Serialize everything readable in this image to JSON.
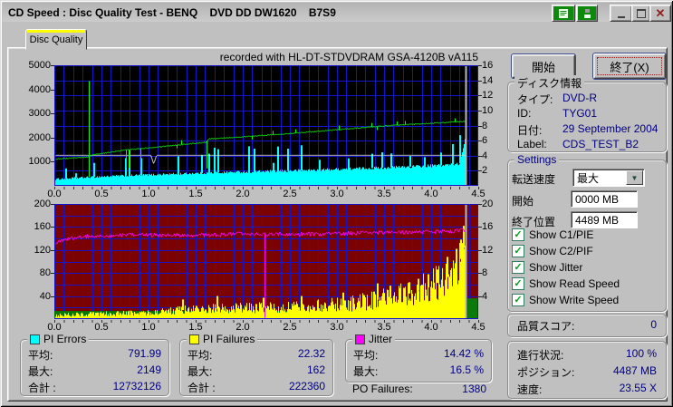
{
  "window": {
    "title": "CD Speed : Disc Quality Test - BENQ    DVD DD DW1620    B7S9"
  },
  "titlebar": {
    "icons": [
      "test-results-icon",
      "save-disk-icon",
      "minimize-icon",
      "maximize-icon",
      "close-icon"
    ]
  },
  "tab": {
    "label": "Disc Quality"
  },
  "actions": {
    "start": "開始",
    "exit": "終了(X)"
  },
  "disc_info": {
    "title": "ディスク情報",
    "type_label": "タイプ:",
    "type_value": "DVD-R",
    "id_label": "ID:",
    "id_value": "TYG01",
    "date_label": "日付:",
    "date_value": "29 September 2004",
    "label_label": "Label:",
    "label_value": "CDS_TEST_B2"
  },
  "settings": {
    "title": "Settings",
    "speed_label": "転送速度",
    "speed_value": "最大",
    "start_label": "開始",
    "start_value": "0000 MB",
    "end_label": "終了位置",
    "end_value": "4489 MB",
    "checkboxes": [
      {
        "label": "Show C1/PIE",
        "checked": true
      },
      {
        "label": "Show C2/PIF",
        "checked": true
      },
      {
        "label": "Show Jitter",
        "checked": true
      },
      {
        "label": "Show Read Speed",
        "checked": true
      },
      {
        "label": "Show Write Speed",
        "checked": true
      }
    ]
  },
  "quality_score": {
    "label": "品質スコア:",
    "value": "0"
  },
  "progress": {
    "rows": [
      {
        "label": "進行状況:",
        "value": "100 %"
      },
      {
        "label": "ポジション:",
        "value": "4487 MB"
      },
      {
        "label": "速度:",
        "value": "23.55 X"
      }
    ]
  },
  "stats": {
    "pi_errors": {
      "legend": "PI Errors",
      "color": "#00ffff",
      "avg_label": "平均:",
      "avg": "791.99",
      "max_label": "最大:",
      "max": "2149",
      "total_label": "合計 :",
      "total": "12732126"
    },
    "pi_failures": {
      "legend": "PI Failures",
      "color": "#ffff00",
      "avg_label": "平均:",
      "avg": "22.32",
      "max_label": "最大:",
      "max": "162",
      "total_label": "合計 :",
      "total": "222360"
    },
    "jitter": {
      "legend": "Jitter",
      "color": "#ff00ff",
      "avg_label": "平均:",
      "avg": "14.42 %",
      "max_label": "最大:",
      "max": "16.5 %"
    },
    "po_failures": {
      "label": "PO Failures:",
      "value": "1380"
    }
  },
  "chart_data": [
    {
      "type": "area",
      "title": "recorded with HL-DT-STDVDRAM GSA-4120B vA115",
      "x_unit": "GB",
      "x_min": 0,
      "x_max": 4.5,
      "x_grid_step": 0.1,
      "x_tick_labels": [
        "0.0",
        "0.5",
        "1.0",
        "1.5",
        "2.0",
        "2.5",
        "3.0",
        "3.5",
        "4.0",
        "4.5"
      ],
      "left_axis": {
        "max": 5000,
        "tick_labels": [
          5000,
          4000,
          3000,
          2000,
          1000
        ]
      },
      "right_axis": {
        "max": 16,
        "tick_labels": [
          16,
          14,
          12,
          10,
          8,
          6,
          4,
          2
        ],
        "divisions": 8
      },
      "background": "#000000",
      "grid_color": "#1414c8",
      "data_end_x": 4.37,
      "end_line_color": "#b8b8b8",
      "series": [
        {
          "name": "PI Errors",
          "kind": "area",
          "axis": "left",
          "color": "#00ffff",
          "points": [
            [
              0,
              270
            ],
            [
              0.1,
              300
            ],
            [
              0.3,
              340
            ],
            [
              0.5,
              385
            ],
            [
              0.75,
              420
            ],
            [
              1.0,
              455
            ],
            [
              1.25,
              490
            ],
            [
              1.5,
              520
            ],
            [
              1.75,
              550
            ],
            [
              2.0,
              575
            ],
            [
              2.25,
              600
            ],
            [
              2.5,
              625
            ],
            [
              2.75,
              655
            ],
            [
              3.0,
              690
            ],
            [
              3.25,
              720
            ],
            [
              3.5,
              755
            ],
            [
              3.75,
              790
            ],
            [
              4.0,
              830
            ],
            [
              4.2,
              870
            ],
            [
              4.3,
              930
            ],
            [
              4.33,
              1500
            ],
            [
              4.37,
              2140
            ]
          ],
          "noise": [
            [
              0,
              40
            ],
            [
              2,
              55
            ],
            [
              4.37,
              70
            ]
          ],
          "spikes": [
            [
              0.12,
              720
            ],
            [
              0.22,
              520
            ],
            [
              0.41,
              950
            ],
            [
              0.75,
              1150
            ],
            [
              0.79,
              1480
            ],
            [
              0.91,
              1150
            ],
            [
              1.31,
              1230
            ],
            [
              1.56,
              1280
            ],
            [
              1.63,
              1330
            ],
            [
              1.69,
              1580
            ],
            [
              1.73,
              1520
            ],
            [
              2.06,
              1640
            ],
            [
              2.12,
              1540
            ],
            [
              2.32,
              950
            ],
            [
              2.37,
              1630
            ],
            [
              2.47,
              1540
            ],
            [
              2.62,
              1680
            ],
            [
              2.81,
              1080
            ],
            [
              3.12,
              1140
            ],
            [
              3.37,
              1330
            ],
            [
              3.47,
              1390
            ],
            [
              3.57,
              1340
            ],
            [
              3.77,
              1240
            ],
            [
              3.92,
              1190
            ],
            [
              4.1,
              1380
            ],
            [
              4.22,
              1730
            ],
            [
              4.3,
              2100
            ]
          ]
        },
        {
          "name": "Read Speed",
          "kind": "line",
          "axis": "right",
          "color": "#d8d8d8",
          "points": [
            [
              0,
              4.05
            ],
            [
              1.02,
              4.05
            ],
            [
              1.05,
              2.9
            ],
            [
              1.08,
              4.05
            ],
            [
              4.37,
              4.05
            ]
          ],
          "noise": 0,
          "spikes": []
        },
        {
          "name": "Write Speed",
          "kind": "line",
          "axis": "right",
          "color": "#00ff00",
          "points": [
            [
              0,
              3.55
            ],
            [
              0.2,
              3.7
            ],
            [
              0.36,
              3.85
            ],
            [
              0.4,
              4.1
            ],
            [
              0.75,
              4.75
            ],
            [
              1.0,
              5.05
            ],
            [
              1.25,
              5.35
            ],
            [
              1.5,
              5.65
            ],
            [
              1.61,
              5.8
            ],
            [
              1.64,
              6.25
            ],
            [
              2.0,
              6.5
            ],
            [
              2.5,
              6.95
            ],
            [
              3.0,
              7.45
            ],
            [
              3.5,
              7.95
            ],
            [
              4.0,
              8.3
            ],
            [
              4.37,
              8.55
            ]
          ],
          "noise": 0.05,
          "spikes": [
            [
              0.37,
              13.9
            ],
            [
              0.37,
              1.2
            ],
            [
              0.755,
              2.4
            ],
            [
              0.79,
              2.4
            ],
            [
              0.915,
              2.5
            ],
            [
              1.3,
              5.0
            ],
            [
              1.35,
              6.05
            ],
            [
              1.62,
              2.3
            ],
            [
              2.1,
              6.15
            ],
            [
              2.32,
              7.3
            ],
            [
              2.56,
              7.5
            ],
            [
              3.02,
              8.0
            ],
            [
              3.37,
              8.35
            ],
            [
              3.42,
              7.4
            ],
            [
              3.63,
              8.55
            ],
            [
              3.72,
              8.6
            ],
            [
              4.25,
              8.95
            ]
          ]
        }
      ]
    },
    {
      "type": "area",
      "x_unit": "GB",
      "x_min": 0,
      "x_max": 4.5,
      "x_grid_step": 0.1,
      "x_tick_labels": [
        "0.0",
        "0.5",
        "1.0",
        "1.5",
        "2.0",
        "2.5",
        "3.0",
        "3.5",
        "4.0",
        "4.5"
      ],
      "left_axis": {
        "max": 200,
        "tick_labels": [
          200,
          160,
          120,
          80,
          40
        ]
      },
      "right_axis": {
        "max": 20,
        "tick_labels": [
          20,
          16,
          12,
          8,
          4
        ],
        "divisions": 10
      },
      "background": "#7a0202",
      "grid_color": "#1414c8",
      "data_end_x": 4.37,
      "end_line_color": "#b8b8b8",
      "band": {
        "x0": 0,
        "x1": 4.37,
        "height": 14,
        "color": "#067806"
      },
      "end_block": {
        "x0": 4.385,
        "x1": 4.5,
        "height": 36,
        "color": "#0a7a0a"
      },
      "series": [
        {
          "name": "PI Failures",
          "kind": "area",
          "axis": "left",
          "color": "#ffff00",
          "points": [
            [
              0,
              7
            ],
            [
              0.5,
              9
            ],
            [
              1.0,
              11
            ],
            [
              1.2,
              14
            ],
            [
              1.5,
              17
            ],
            [
              2.0,
              19
            ],
            [
              2.5,
              21
            ],
            [
              3.0,
              25
            ],
            [
              3.2,
              28
            ],
            [
              3.4,
              33
            ],
            [
              3.6,
              38
            ],
            [
              3.8,
              46
            ],
            [
              3.95,
              54
            ],
            [
              4.1,
              66
            ],
            [
              4.2,
              78
            ],
            [
              4.3,
              98
            ],
            [
              4.35,
              130
            ],
            [
              4.37,
              150
            ]
          ],
          "noise": [
            [
              0,
              4
            ],
            [
              1.0,
              5
            ],
            [
              1.5,
              9
            ],
            [
              2.5,
              10
            ],
            [
              3.0,
              13
            ],
            [
              3.5,
              18
            ],
            [
              3.8,
              24
            ],
            [
              4.0,
              30
            ],
            [
              4.2,
              36
            ],
            [
              4.37,
              40
            ]
          ],
          "spikes": [
            [
              1.36,
              34
            ],
            [
              1.72,
              40
            ],
            [
              2.21,
              37
            ],
            [
              2.62,
              40
            ],
            [
              3.06,
              46
            ],
            [
              3.42,
              62
            ],
            [
              3.56,
              58
            ],
            [
              3.66,
              54
            ],
            [
              3.76,
              64
            ],
            [
              3.86,
              70
            ],
            [
              3.96,
              78
            ],
            [
              4.06,
              86
            ],
            [
              4.16,
              108
            ],
            [
              4.26,
              122
            ],
            [
              4.31,
              138
            ],
            [
              4.34,
              162
            ]
          ]
        },
        {
          "name": "Jitter",
          "kind": "line",
          "axis": "right",
          "color": "#ff00ff",
          "points": [
            [
              0,
              13.2
            ],
            [
              0.15,
              14.0
            ],
            [
              0.4,
              14.45
            ],
            [
              1.0,
              14.6
            ],
            [
              1.5,
              14.55
            ],
            [
              2.0,
              14.75
            ],
            [
              2.5,
              14.7
            ],
            [
              3.0,
              14.85
            ],
            [
              3.5,
              15.0
            ],
            [
              4.0,
              15.15
            ],
            [
              4.2,
              15.3
            ],
            [
              4.37,
              15.45
            ]
          ],
          "noise": 0.35,
          "spikes": [
            [
              2.23,
              0.2
            ]
          ]
        }
      ]
    }
  ]
}
